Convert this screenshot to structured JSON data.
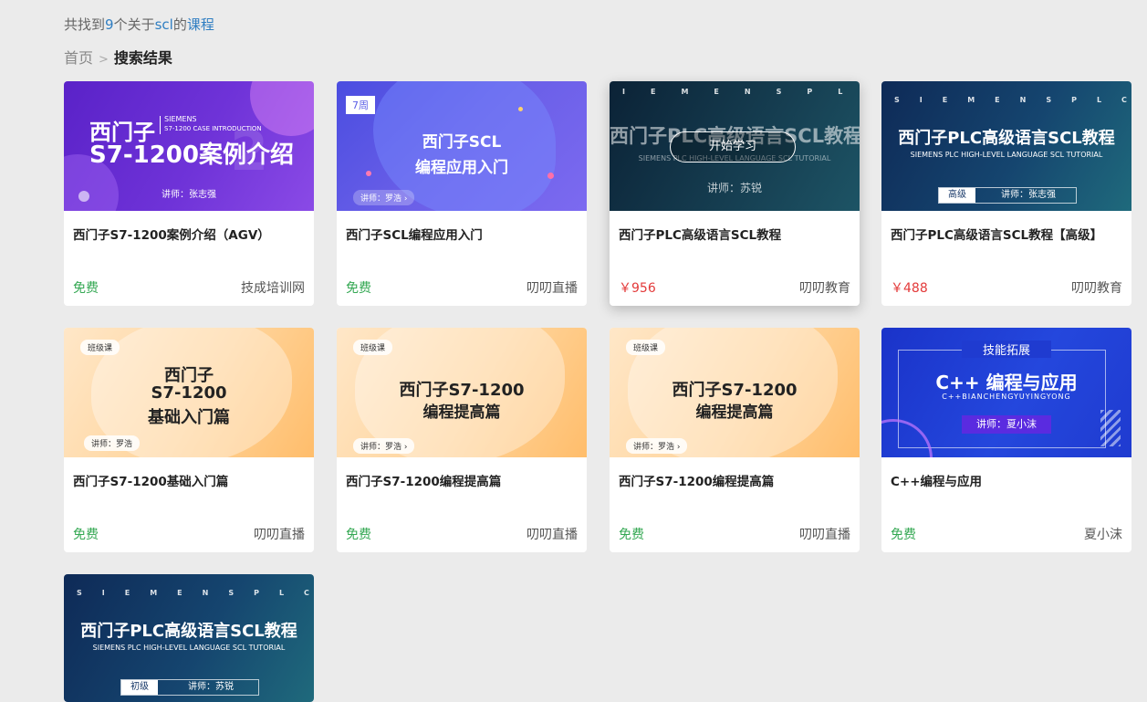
{
  "summary": {
    "prefix": "共找到",
    "count": "9",
    "middle": "个关于",
    "keyword": "scl",
    "suffix1": "的",
    "suffix2": "课程"
  },
  "breadcrumb": {
    "home": "首页",
    "sep": ">",
    "current": "搜索结果"
  },
  "hover_button": "开始学习",
  "courses": [
    {
      "title": "西门子S7-1200案例介绍（AGV）",
      "price": "免费",
      "org": "技成培训网",
      "thumb": {
        "brand": "SIEMENS",
        "sub": "S7-1200 CASE INTRODUCTION",
        "line1": "西门子",
        "line2": "S7-1200案例介绍",
        "teacher": "讲师：张志强",
        "digit": "2"
      }
    },
    {
      "title": "西门子SCL编程应用入门",
      "price": "免费",
      "org": "叨叨直播",
      "thumb": {
        "badge": "7周",
        "line1": "西门子SCL",
        "line2": "编程应用入门",
        "teacher": "讲师：罗浩 ›"
      }
    },
    {
      "title": "西门子PLC高级语言SCL教程",
      "price": "￥956",
      "org": "叨叨教育",
      "thumb": {
        "letters": "IEMENSPL",
        "line1": "西门子PLC高级语言SCL教程",
        "sub": "SIEMENS PLC HIGH-LEVEL LANGUAGE SCL TUTORIAL",
        "teacher": "讲师：苏锐"
      }
    },
    {
      "title": "西门子PLC高级语言SCL教程【高级】",
      "price": "￥488",
      "org": "叨叨教育",
      "thumb": {
        "letters": "SIEMENSPLC",
        "line1": "西门子PLC高级语言SCL教程",
        "sub": "SIEMENS PLC HIGH-LEVEL LANGUAGE SCL TUTORIAL",
        "level": "高级",
        "teacher": "讲师：张志强"
      }
    },
    {
      "title": "西门子S7-1200基础入门篇",
      "price": "免费",
      "org": "叨叨直播",
      "thumb": {
        "badge": "班级课",
        "line1": "西门子",
        "line2": "S7-1200",
        "line3": "基础入门篇",
        "teacher": "讲师：罗浩"
      }
    },
    {
      "title": "西门子S7-1200编程提高篇",
      "price": "免费",
      "org": "叨叨直播",
      "thumb": {
        "badge": "班级课",
        "line1": "西门子S7-1200",
        "line2": "编程提高篇",
        "teacher": "讲师：罗浩 ›"
      }
    },
    {
      "title": "西门子S7-1200编程提高篇",
      "price": "免费",
      "org": "叨叨直播",
      "thumb": {
        "badge": "班级课",
        "line1": "西门子S7-1200",
        "line2": "编程提高篇",
        "teacher": "讲师：罗浩 ›"
      }
    },
    {
      "title": "C++编程与应用",
      "price": "免费",
      "org": "夏小沫",
      "thumb": {
        "top": "技能拓展",
        "line1": "C++ 编程与应用",
        "sub": "C++BIANCHENGYUYINGYONG",
        "teacher": "讲师：夏小沫"
      }
    },
    {
      "title": "",
      "price": "",
      "org": "",
      "thumb": {
        "letters": "SIEMENSPLC",
        "line1": "西门子PLC高级语言SCL教程",
        "sub": "SIEMENS PLC HIGH-LEVEL LANGUAGE SCL TUTORIAL",
        "level": "初级",
        "teacher": "讲师：苏锐"
      }
    }
  ]
}
